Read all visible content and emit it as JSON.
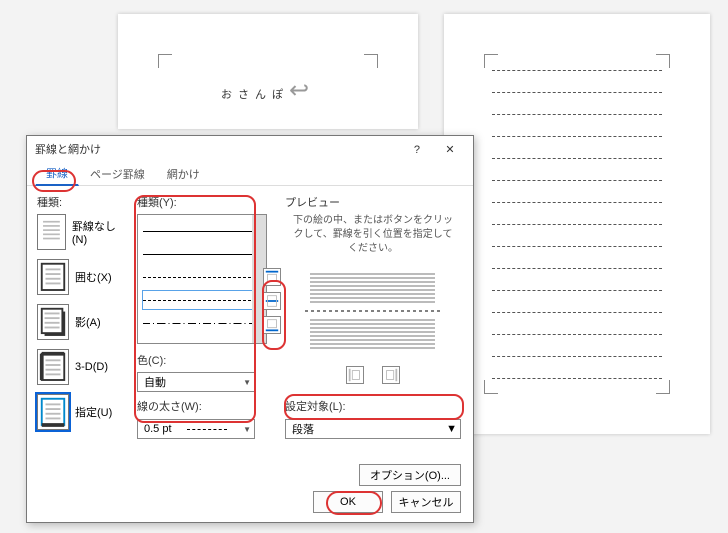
{
  "doc": {
    "title_text": "おさんぽ",
    "return_symbol": "↩"
  },
  "dialog": {
    "title": "罫線と網かけ",
    "help_symbol": "?",
    "close_symbol": "✕",
    "tabs": [
      "罫線",
      "ページ罫線",
      "網かけ"
    ],
    "active_tab": 0,
    "settings": {
      "label": "種類:",
      "items": [
        {
          "label": "罫線なし(N)"
        },
        {
          "label": "囲む(X)"
        },
        {
          "label": "影(A)"
        },
        {
          "label": "3-D(D)"
        },
        {
          "label": "指定(U)"
        }
      ],
      "selected_index": 4
    },
    "style": {
      "label": "種類(Y):",
      "styles": [
        "solid",
        "solid-thin",
        "dashed-thick",
        "dashed",
        "dashdot"
      ],
      "selected_index": 3
    },
    "color": {
      "label": "色(C):",
      "value": "自動"
    },
    "width": {
      "label": "線の太さ(W):",
      "value": "0.5 pt"
    },
    "preview": {
      "label": "プレビュー",
      "hint": "下の絵の中、またはボタンをクリックして、罫線を引く位置を指定してください。"
    },
    "apply_to": {
      "label": "設定対象(L):",
      "value": "段落"
    },
    "options_button": "オプション(O)...",
    "buttons": {
      "ok": "OK",
      "cancel": "キャンセル"
    }
  }
}
